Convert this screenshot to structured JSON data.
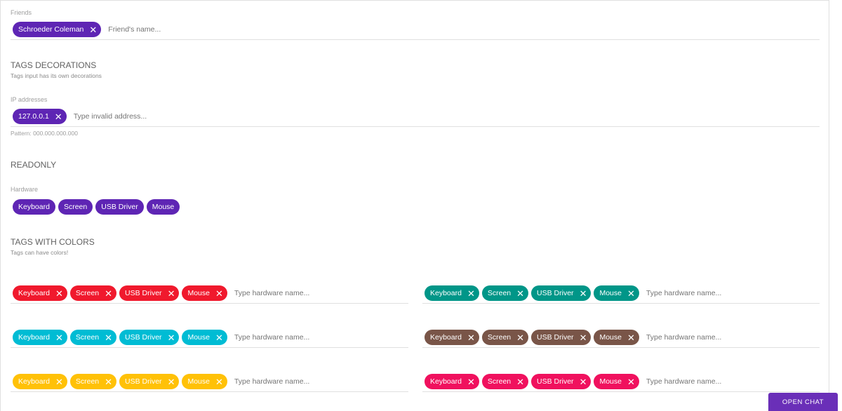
{
  "friends": {
    "label": "Friends",
    "chips": [
      "Schroeder Coleman"
    ],
    "placeholder": "Friend's name..."
  },
  "tags_decorations": {
    "title": "TAGS DECORATIONS",
    "subtitle": "Tags input has its own decorations",
    "ip_label": "IP addresses",
    "chips": [
      "127.0.0.1"
    ],
    "placeholder": "Type invalid address...",
    "pattern_hint": "Pattern: 000.000.000.000"
  },
  "readonly": {
    "title": "READONLY",
    "label": "Hardware",
    "chips": [
      "Keyboard",
      "Screen",
      "USB Driver",
      "Mouse"
    ]
  },
  "tags_with_colors": {
    "title": "TAGS WITH COLORS",
    "subtitle": "Tags can have colors!",
    "chips": [
      "Keyboard",
      "Screen",
      "USB Driver",
      "Mouse"
    ],
    "placeholder": "Type hardware name...",
    "colors": {
      "red": "#f0192d",
      "teal": "#009688",
      "cyan": "#00bcd4",
      "brown": "#795548",
      "amber": "#ffc107",
      "pink": "#f0115e"
    }
  },
  "primary_color": "#5e25b4",
  "close_icon": "close-icon",
  "chat": {
    "label": "OPEN CHAT"
  }
}
